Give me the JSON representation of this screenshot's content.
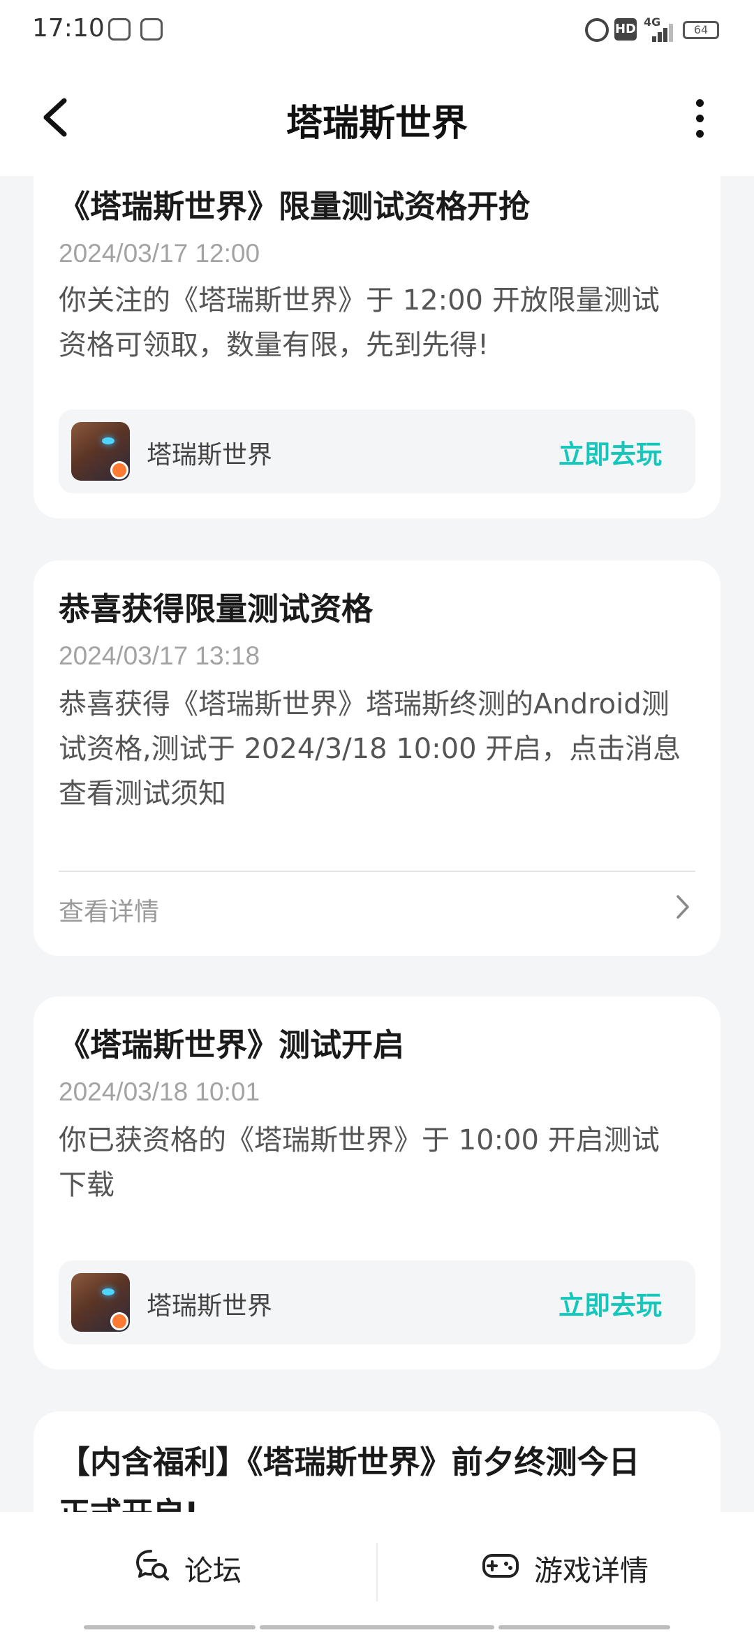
{
  "status_bar": {
    "time": "17:10",
    "network": "4G",
    "hd": "HD",
    "battery": "64"
  },
  "header": {
    "title": "塔瑞斯世界"
  },
  "messages": [
    {
      "title": "《塔瑞斯世界》限量测试资格开抢",
      "time": "2024/03/17 12:00",
      "body_lines": [
        "你关注的《塔瑞斯世界》于 12:00 开放限量测试",
        "资格可领取，数量有限，先到先得!"
      ],
      "game_name": "塔瑞斯世界",
      "action_label": "立即去玩"
    },
    {
      "title": "恭喜获得限量测试资格",
      "time": "2024/03/17 13:18",
      "body_lines": [
        "恭喜获得《塔瑞斯世界》塔瑞斯终测的Android测",
        "试资格,测试于 2024/3/18 10:00 开启，点击消息",
        "查看测试须知"
      ],
      "detail_label": "查看详情"
    },
    {
      "title": "《塔瑞斯世界》测试开启",
      "time": "2024/03/18 10:01",
      "body_lines": [
        "你已获资格的《塔瑞斯世界》于 10:00 开启测试",
        "下载"
      ],
      "game_name": "塔瑞斯世界",
      "action_label": "立即去玩"
    },
    {
      "title_lines": [
        "【内含福利】《塔瑞斯世界》前夕终测今日",
        "正式开启!"
      ]
    }
  ],
  "bottom_bar": {
    "forum_label": "论坛",
    "game_detail_label": "游戏详情"
  },
  "icons": {
    "back": "chevron-left-icon",
    "more": "more-vertical-icon",
    "forum": "chat-search-icon",
    "game": "gamepad-icon",
    "detail": "chevron-right-icon"
  },
  "colors": {
    "accent": "#15c6bb",
    "background": "#f4f5f7",
    "card": "#ffffff"
  }
}
